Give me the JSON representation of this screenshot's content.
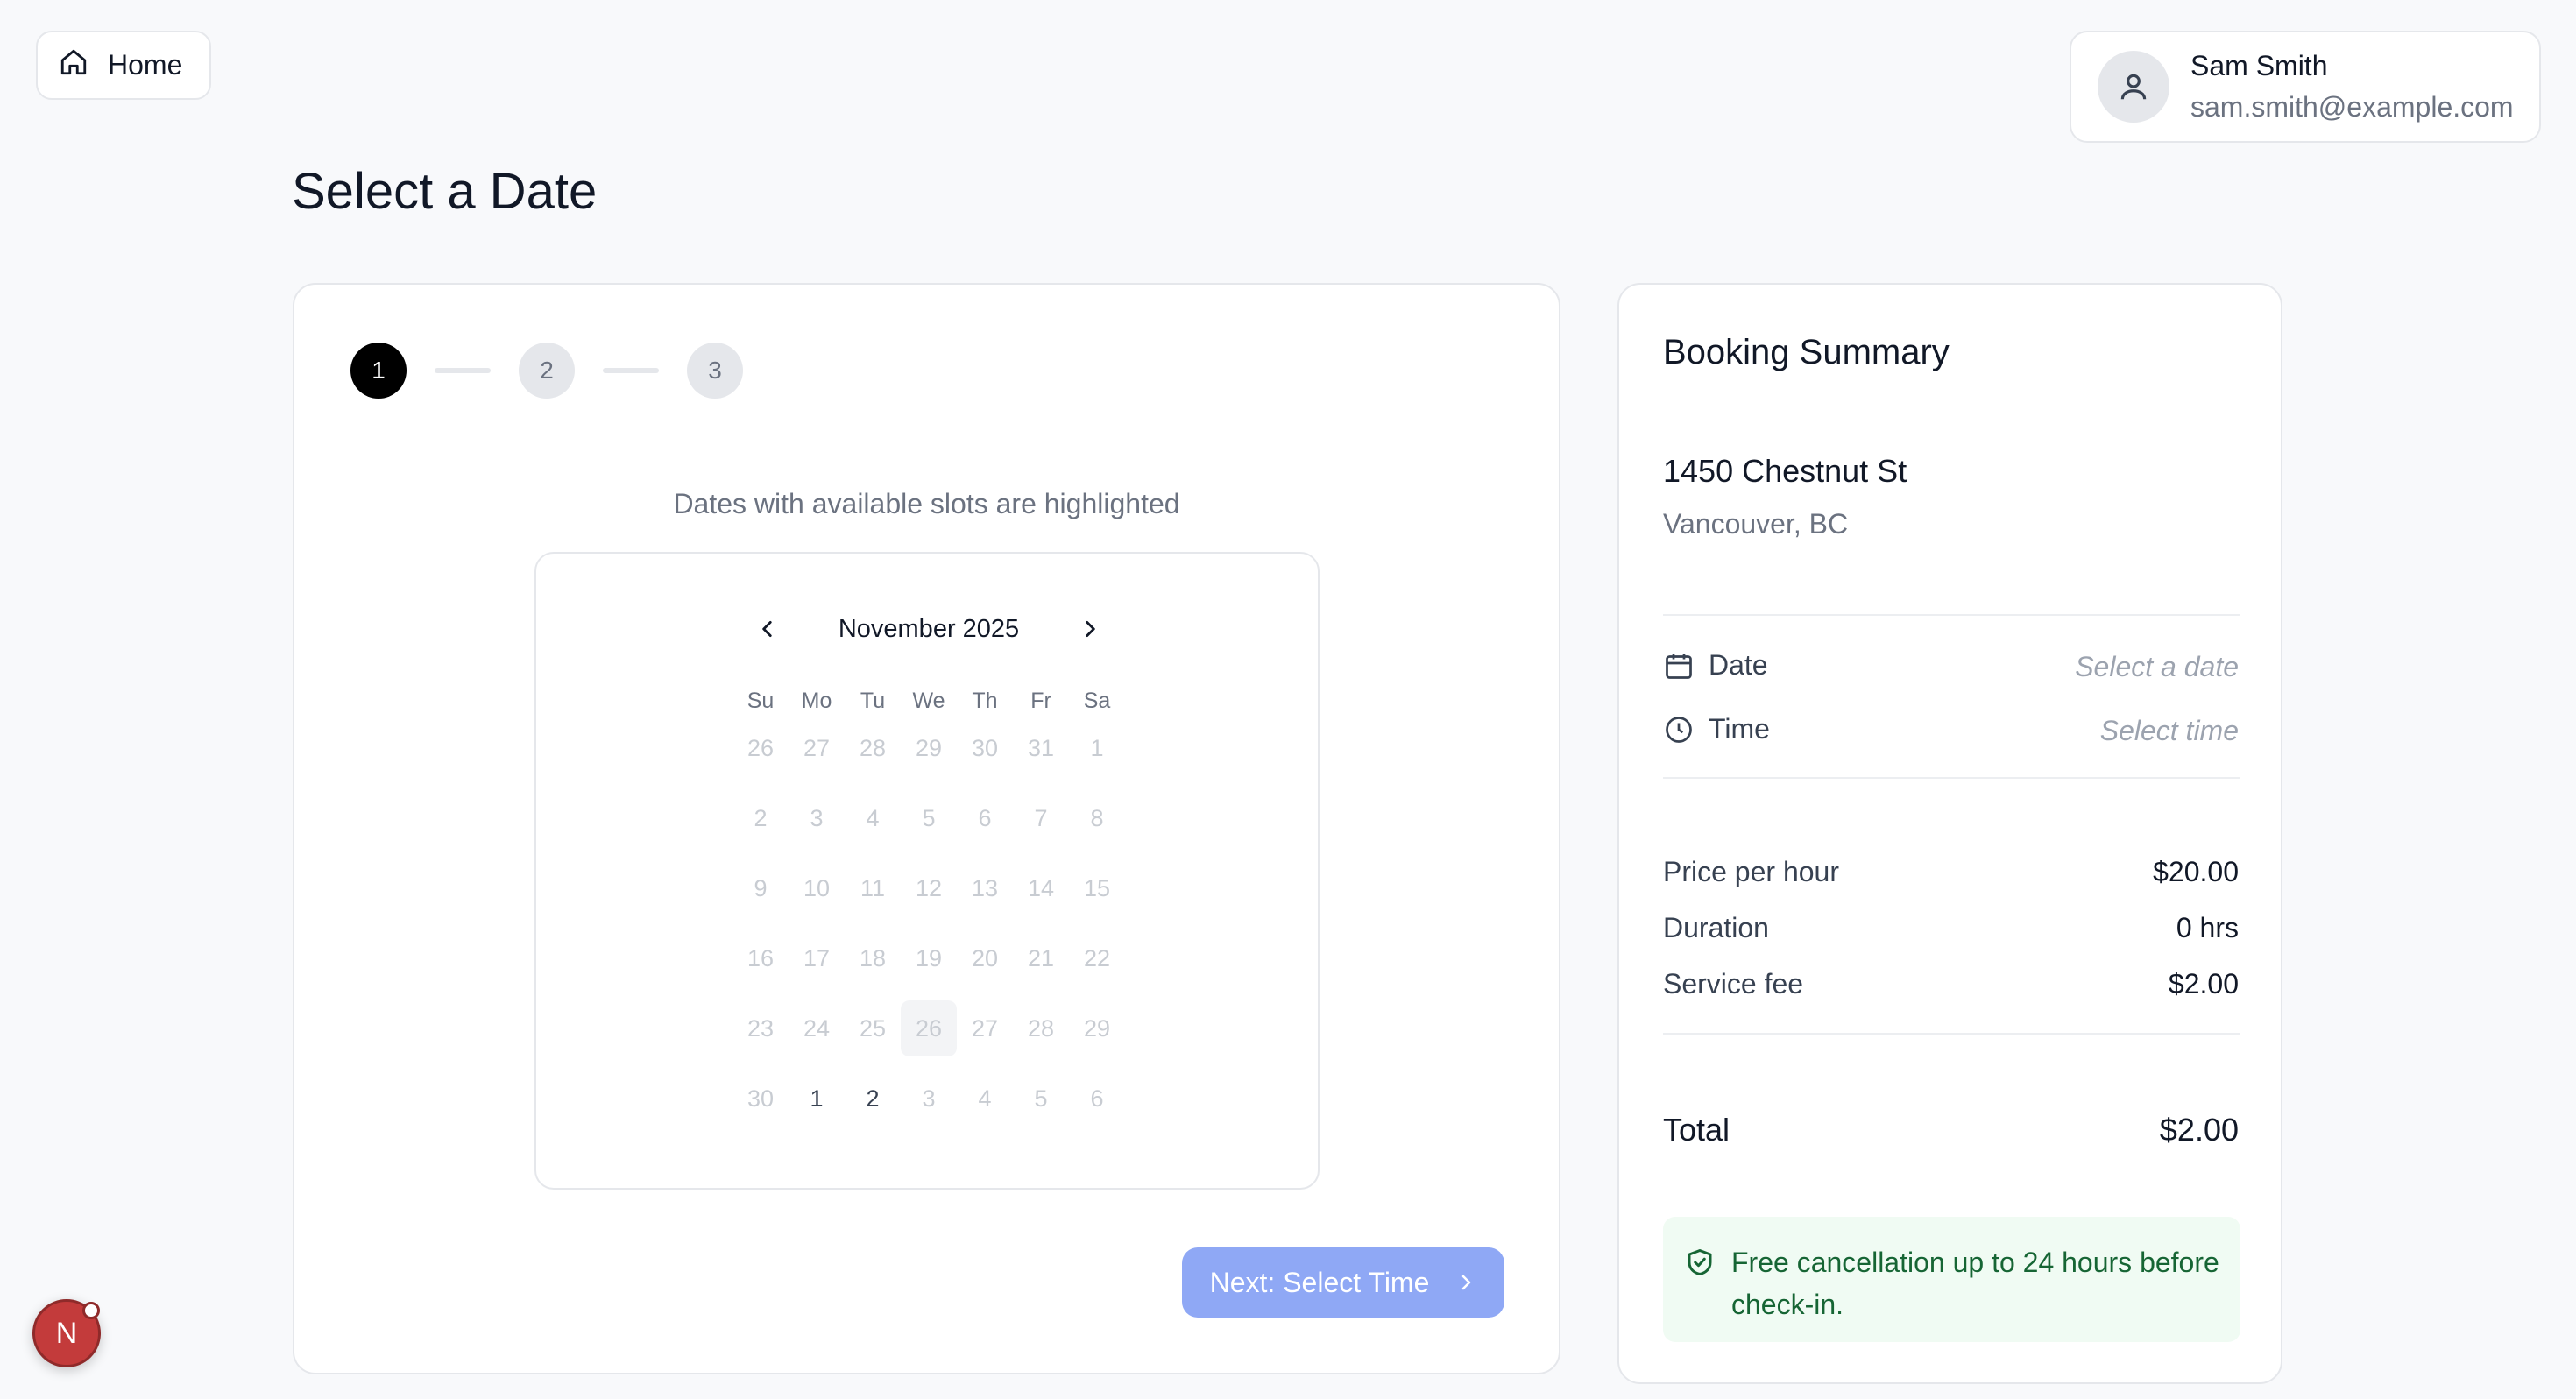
{
  "nav": {
    "home_label": "Home"
  },
  "user": {
    "name": "Sam Smith",
    "email": "sam.smith@example.com"
  },
  "page": {
    "title": "Select a Date"
  },
  "steps": [
    "1",
    "2",
    "3"
  ],
  "calendar": {
    "hint": "Dates with available slots are highlighted",
    "month_label": "November 2025",
    "weekdays": [
      "Su",
      "Mo",
      "Tu",
      "We",
      "Th",
      "Fr",
      "Sa"
    ],
    "weeks": [
      [
        "26",
        "27",
        "28",
        "29",
        "30",
        "31",
        "1"
      ],
      [
        "2",
        "3",
        "4",
        "5",
        "6",
        "7",
        "8"
      ],
      [
        "9",
        "10",
        "11",
        "12",
        "13",
        "14",
        "15"
      ],
      [
        "16",
        "17",
        "18",
        "19",
        "20",
        "21",
        "22"
      ],
      [
        "23",
        "24",
        "25",
        "26",
        "27",
        "28",
        "29"
      ],
      [
        "30",
        "1",
        "2",
        "3",
        "4",
        "5",
        "6"
      ]
    ],
    "available": [
      "5-1",
      "5-2"
    ],
    "today": "4-3"
  },
  "actions": {
    "next_label": "Next: Select Time"
  },
  "summary": {
    "title": "Booking Summary",
    "address_line1": "1450 Chestnut St",
    "address_line2": "Vancouver, BC",
    "date_label": "Date",
    "date_value": "Select a date",
    "time_label": "Time",
    "time_value": "Select time",
    "price_label": "Price per hour",
    "price_value": "$20.00",
    "duration_label": "Duration",
    "duration_value": "0 hrs",
    "fee_label": "Service fee",
    "fee_value": "$2.00",
    "total_label": "Total",
    "total_value": "$2.00",
    "note": "Free cancellation up to 24 hours before check-in."
  },
  "bubble": {
    "letter": "N"
  },
  "colors": {
    "primary_disabled": "#8fa8f5",
    "success_bg": "#f0fbf3",
    "success_text": "#166534"
  }
}
